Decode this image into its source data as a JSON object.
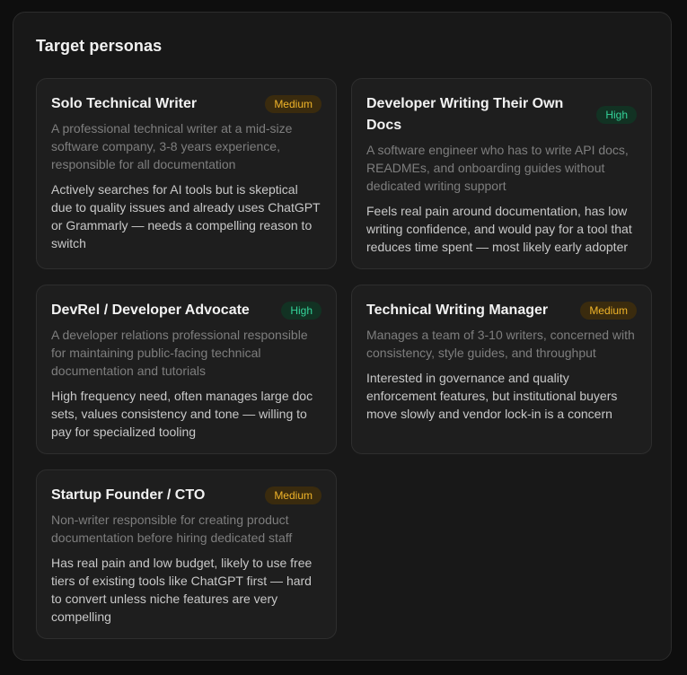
{
  "section": {
    "title": "Target personas"
  },
  "colors": {
    "medium_badge": "#f0b429",
    "high_badge": "#34d399"
  },
  "personas": [
    {
      "name": "Solo Technical Writer",
      "priority": "Medium",
      "description": "A professional technical writer at a mid-size software company, 3-8 years experience, responsible for all documentation",
      "note": "Actively searches for AI tools but is skeptical due to quality issues and already uses ChatGPT or Grammarly — needs a compelling reason to switch"
    },
    {
      "name": "Developer Writing Their Own Docs",
      "priority": "High",
      "description": "A software engineer who has to write API docs, READMEs, and onboarding guides without dedicated writing support",
      "note": "Feels real pain around documentation, has low writing confidence, and would pay for a tool that reduces time spent — most likely early adopter"
    },
    {
      "name": "DevRel / Developer Advocate",
      "priority": "High",
      "description": "A developer relations professional responsible for maintaining public-facing technical documentation and tutorials",
      "note": "High frequency need, often manages large doc sets, values consistency and tone — willing to pay for specialized tooling"
    },
    {
      "name": "Technical Writing Manager",
      "priority": "Medium",
      "description": "Manages a team of 3-10 writers, concerned with consistency, style guides, and throughput",
      "note": "Interested in governance and quality enforcement features, but institutional buyers move slowly and vendor lock-in is a concern"
    },
    {
      "name": "Startup Founder / CTO",
      "priority": "Medium",
      "description": "Non-writer responsible for creating product documentation before hiring dedicated staff",
      "note": "Has real pain and low budget, likely to use free tiers of existing tools like ChatGPT first — hard to convert unless niche features are very compelling"
    }
  ]
}
